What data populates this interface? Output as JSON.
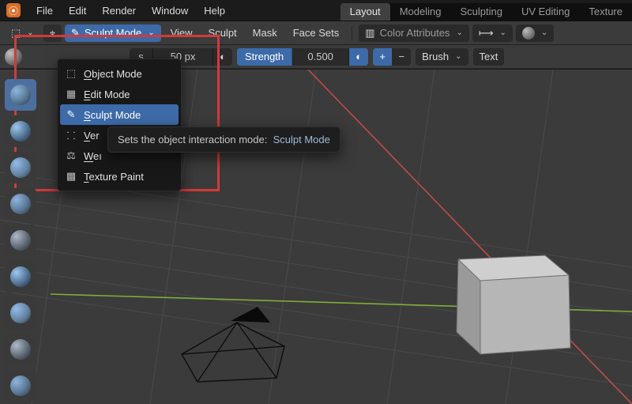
{
  "menubar": {
    "items": [
      "File",
      "Edit",
      "Render",
      "Window",
      "Help"
    ]
  },
  "workspace_tabs": [
    "Layout",
    "Modeling",
    "Sculpting",
    "UV Editing",
    "Texture"
  ],
  "active_workspace": "Layout",
  "header1": {
    "mode_current": "Sculpt Mode",
    "menus": [
      "View",
      "Sculpt",
      "Mask",
      "Face Sets"
    ],
    "overlay_label": "Color Attributes"
  },
  "header2": {
    "radius_label_suffix": "s",
    "radius_value": "50 px",
    "strength_label": "Strength",
    "strength_value": "0.500",
    "plus": "+",
    "minus": "−",
    "brush_label": "Brush",
    "texture_label": "Text"
  },
  "mode_dropdown": {
    "items": [
      {
        "icon": "⬚",
        "label": "Object Mode",
        "u": "O"
      },
      {
        "icon": "▦",
        "label": "Edit Mode",
        "u": "E"
      },
      {
        "icon": "✎",
        "label": "Sculpt Mode",
        "u": "S",
        "active": true
      },
      {
        "icon": "⸬",
        "label": "Ver",
        "u": "V"
      },
      {
        "icon": "⚖",
        "label": "Weı",
        "u": "W"
      },
      {
        "icon": "▩",
        "label": "Texture Paint",
        "u": "T"
      }
    ]
  },
  "tooltip": {
    "lead": "Sets the object interaction mode:",
    "value": "Sculpt Mode"
  },
  "icons": {
    "brush": "✎",
    "chevron_down": "⌄",
    "pressure": "◐",
    "hud": "⊞"
  }
}
